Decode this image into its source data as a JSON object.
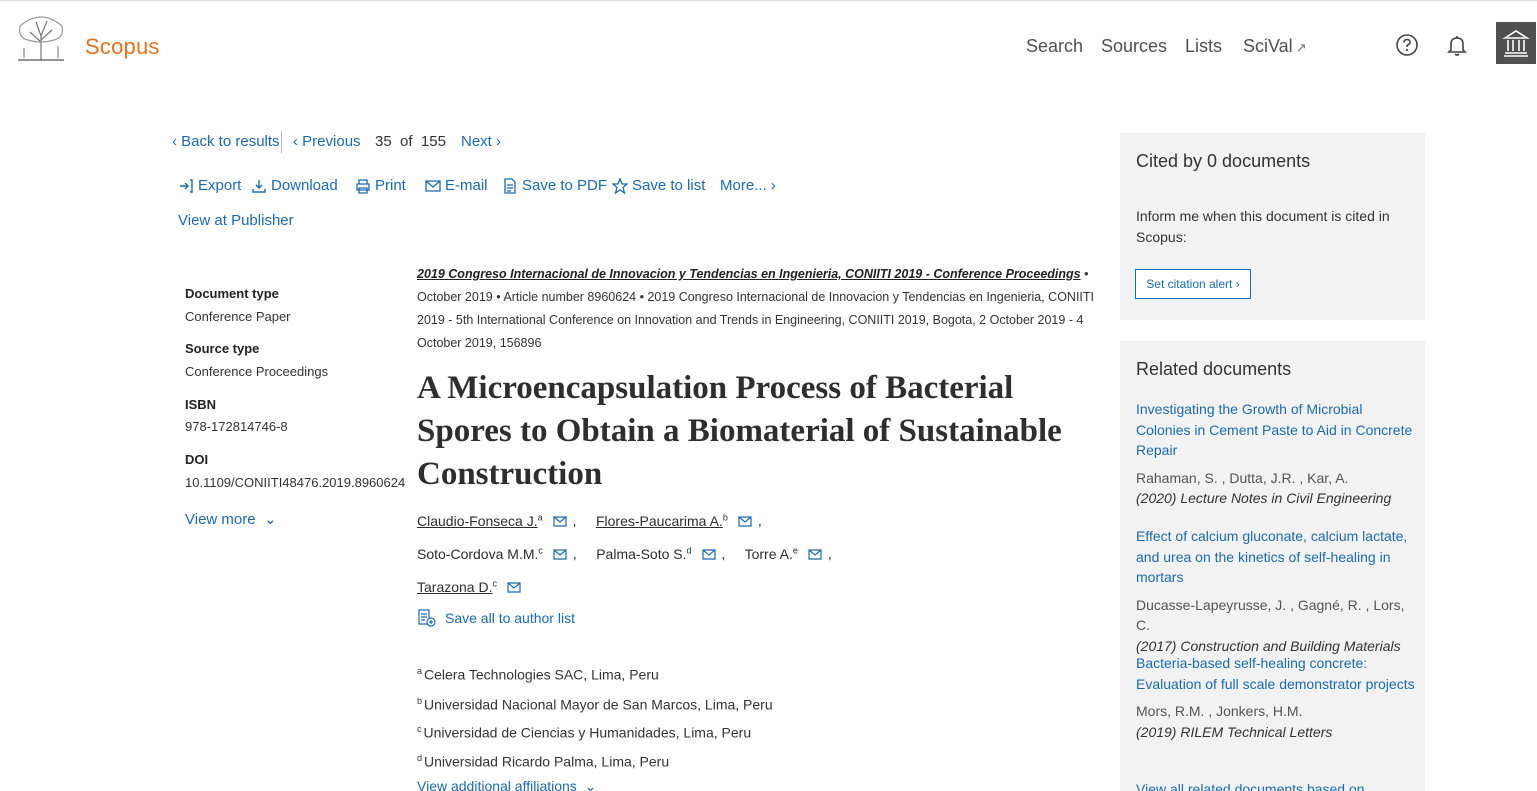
{
  "header": {
    "brand": "Scopus",
    "nav": [
      "Search",
      "Sources",
      "Lists",
      "SciVal"
    ],
    "icons": [
      "elsevier-tree-logo",
      "help-icon",
      "bell-icon",
      "institution-icon"
    ],
    "colors": {
      "brand": "#e9711c",
      "link": "#1b6ab2",
      "institution_bg": "#505050"
    }
  },
  "result_nav": {
    "back": "Back to results",
    "previous": "Previous",
    "position": "35",
    "of": "of",
    "total": "155",
    "next": "Next"
  },
  "toolbar": {
    "export": "Export",
    "download": "Download",
    "print": "Print",
    "email": "E-mail",
    "pdf": "Save to PDF",
    "save_list": "Save to list",
    "more": "More...",
    "publisher": "View at Publisher"
  },
  "meta": {
    "doc_type_label": "Document type",
    "doc_type": "Conference Paper",
    "source_type_label": "Source type",
    "source_type": "Conference Proceedings",
    "isbn_label": "ISBN",
    "isbn": "978-172814746-8",
    "doi_label": "DOI",
    "doi": "10.1109/CONIITI48476.2019.8960624",
    "view_more": "View more"
  },
  "source": {
    "link": "2019 Congreso Internacional de Innovacion y Tendencias en Ingenieria, CONIITI 2019 - Conference Proceedings",
    "rest": " • October 2019 • Article number 8960624 • 2019 Congreso Internacional de Innovacion y Tendencias en Ingenieria, CONIITI 2019 - 5th International Conference on Innovation and Trends in Engineering, CONIITI 2019, Bogota, 2 October 2019 - 4 October 2019, 156896"
  },
  "title": "A Microencapsulation Process of Bacterial Spores to Obtain a Biomaterial of Sustainable Construction",
  "authors": [
    {
      "name": "Claudio-Fonseca J.",
      "sup": "a"
    },
    {
      "name": "Flores-Paucarima A.",
      "sup": "b"
    },
    {
      "name": "Soto-Cordova M.M.",
      "sup": "c"
    },
    {
      "name": "Palma-Soto S.",
      "sup": "d"
    },
    {
      "name": "Torre A.",
      "sup": "e"
    },
    {
      "name": "Tarazona D.",
      "sup": "c"
    }
  ],
  "save_all": "Save all to author list",
  "affiliations": [
    {
      "sup": "a",
      "text": "Celera Technologies SAC, Lima, Peru"
    },
    {
      "sup": "b",
      "text": "Universidad Nacional Mayor de San Marcos, Lima, Peru"
    },
    {
      "sup": "c",
      "text": "Universidad de Ciencias y Humanidades, Lima, Peru"
    },
    {
      "sup": "d",
      "text": "Universidad Ricardo Palma, Lima, Peru"
    }
  ],
  "view_affiliations": "View additional affiliations",
  "cited": {
    "title": "Cited by 0 documents",
    "text": "Inform me when this document is cited in Scopus:",
    "button": "Set citation alert"
  },
  "related": {
    "title": "Related documents",
    "items": [
      {
        "title": "Investigating the Growth of Microbial Colonies in Cement Paste to Aid in Concrete Repair",
        "authors": "Rahaman, S. , Dutta, J.R. , Kar, A.",
        "source": "(2020) Lecture Notes in Civil Engineering"
      },
      {
        "title": "Effect of calcium gluconate, calcium lactate, and urea on the kinetics of self-healing in mortars",
        "authors": "Ducasse-Lapeyrusse, J. , Gagné, R. , Lors, C.",
        "source": "(2017) Construction and Building Materials"
      },
      {
        "title": "Bacteria-based self-healing concrete: Evaluation of full scale demonstrator projects",
        "authors": "Mors, R.M. , Jonkers, H.M.",
        "source": "(2019) RILEM Technical Letters"
      }
    ],
    "more": "View all related documents based on"
  }
}
